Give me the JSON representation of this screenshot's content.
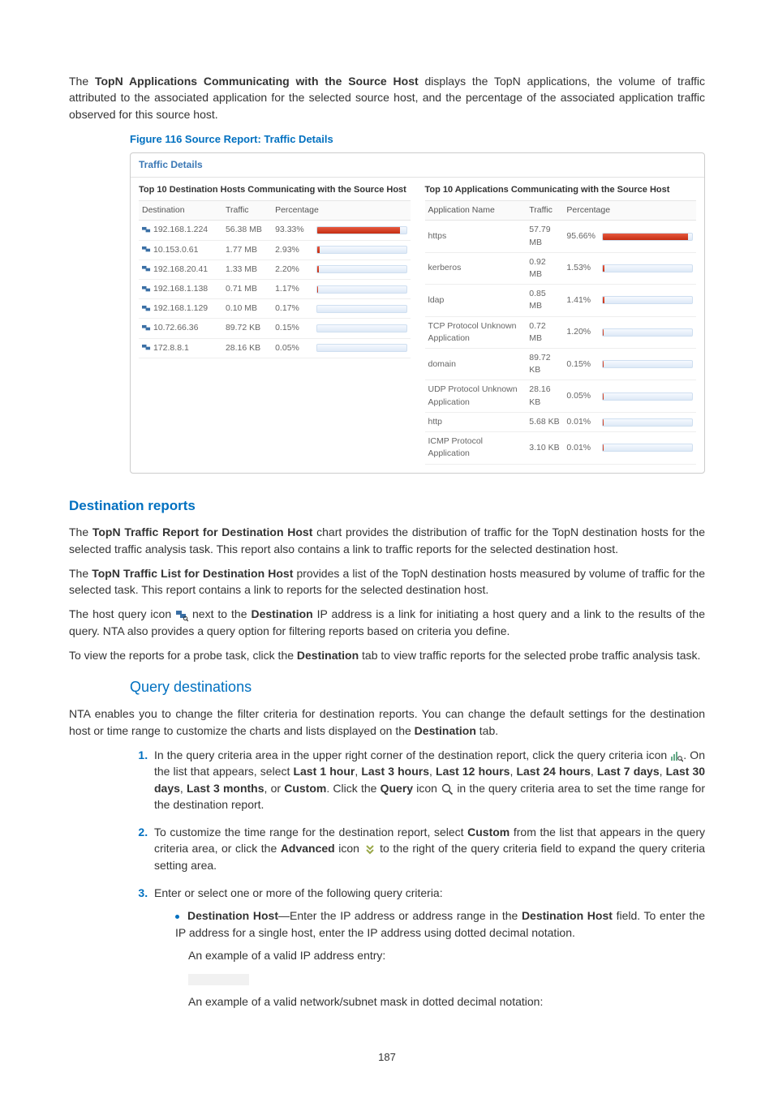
{
  "intro": {
    "p1_prefix": "The ",
    "p1_bold": "TopN Applications Communicating with the Source Host",
    "p1_rest": " displays the TopN applications, the volume of traffic attributed to the associated application for the selected source host, and the percentage of the associated application traffic observed for this source host."
  },
  "figure": {
    "caption": "Figure 116 Source Report: Traffic Details",
    "panel_title": "Traffic Details",
    "left": {
      "title": "Top 10 Destination Hosts Communicating with the Source Host",
      "headers": [
        "Destination",
        "Traffic",
        "Percentage"
      ],
      "rows": [
        {
          "dest": "192.168.1.224",
          "traffic": "56.38 MB",
          "pct": "93.33%",
          "barpct": 93.33
        },
        {
          "dest": "10.153.0.61",
          "traffic": "1.77 MB",
          "pct": "2.93%",
          "barpct": 2.93
        },
        {
          "dest": "192.168.20.41",
          "traffic": "1.33 MB",
          "pct": "2.20%",
          "barpct": 2.2
        },
        {
          "dest": "192.168.1.138",
          "traffic": "0.71 MB",
          "pct": "1.17%",
          "barpct": 1.17
        },
        {
          "dest": "192.168.1.129",
          "traffic": "0.10 MB",
          "pct": "0.17%",
          "barpct": 0.17
        },
        {
          "dest": "10.72.66.36",
          "traffic": "89.72 KB",
          "pct": "0.15%",
          "barpct": 0.15
        },
        {
          "dest": "172.8.8.1",
          "traffic": "28.16 KB",
          "pct": "0.05%",
          "barpct": 0.05
        }
      ]
    },
    "right": {
      "title": "Top 10 Applications Communicating with the Source Host",
      "headers": [
        "Application Name",
        "Traffic",
        "Percentage"
      ],
      "rows": [
        {
          "app": "https",
          "traffic": "57.79 MB",
          "pct": "95.66%",
          "barpct": 95.66
        },
        {
          "app": "kerberos",
          "traffic": "0.92 MB",
          "pct": "1.53%",
          "barpct": 1.53
        },
        {
          "app": "ldap",
          "traffic": "0.85 MB",
          "pct": "1.41%",
          "barpct": 1.41
        },
        {
          "app": "TCP Protocol Unknown Application",
          "traffic": "0.72 MB",
          "pct": "1.20%",
          "barpct": 1.2
        },
        {
          "app": "domain",
          "traffic": "89.72 KB",
          "pct": "0.15%",
          "barpct": 0.15
        },
        {
          "app": "UDP Protocol Unknown Application",
          "traffic": "28.16 KB",
          "pct": "0.05%",
          "barpct": 0.05
        },
        {
          "app": "http",
          "traffic": "5.68 KB",
          "pct": "0.01%",
          "barpct": 0.01
        },
        {
          "app": "ICMP Protocol Application",
          "traffic": "3.10 KB",
          "pct": "0.01%",
          "barpct": 0.01
        }
      ]
    }
  },
  "section_dest": {
    "heading": "Destination reports",
    "p1_a": "The ",
    "p1_b": "TopN Traffic Report for Destination Host",
    "p1_c": " chart provides the distribution of traffic for the TopN destination hosts for the selected traffic analysis task. This report also contains a link to traffic reports for the selected destination host.",
    "p2_a": "The ",
    "p2_b": "TopN Traffic List for Destination Host",
    "p2_c": " provides a list of the TopN destination hosts measured by volume of traffic for the selected task. This report contains a link to reports for the selected destination host.",
    "p3_a": "The host query icon ",
    "p3_b": " next to the ",
    "p3_c": "Destination",
    "p3_d": " IP address is a link for initiating a host query and a link to the results of the query. NTA also provides a query option for filtering reports based on criteria you define.",
    "p4_a": "To view the reports for a probe task, click the ",
    "p4_b": "Destination",
    "p4_c": " tab to view traffic reports for the selected probe traffic analysis task."
  },
  "section_query": {
    "heading": "Query destinations",
    "p1_a": "NTA enables you to change the filter criteria for destination reports. You can change the default settings for the destination host or time range to customize the charts and lists displayed on the ",
    "p1_b": "Destination",
    "p1_c": " tab.",
    "step1_a": "In the query criteria area in the upper right corner of the destination report, click the query criteria icon ",
    "step1_b": ". On the list that appears, select ",
    "step1_opts": [
      "Last 1 hour",
      "Last 3 hours",
      "Last 12 hours",
      "Last 24 hours",
      "Last 7 days",
      "Last 30 days",
      "Last 3 months"
    ],
    "step1_custom": "Custom",
    "step1_click": ". Click the ",
    "step1_query": "Query",
    "step1_icon_after": " icon ",
    "step1_tail": " in the query criteria area to set the time range for the destination report.",
    "step2_a": "To customize the time range for the destination report, select ",
    "step2_b": "Custom",
    "step2_c": " from the list that appears in the query criteria area, or click the ",
    "step2_d": "Advanced",
    "step2_e": " icon ",
    "step2_f": " to the right of the query criteria field to expand the query criteria setting area.",
    "step3": "Enter or select one or more of the following query criteria:",
    "bullet1_a": "Destination Host",
    "bullet1_b": "—Enter the IP address or address range in the ",
    "bullet1_c": "Destination Host",
    "bullet1_d": " field. To enter the IP address for a single host, enter the IP address using dotted decimal notation.",
    "bullet1_line2": "An example of a valid IP address entry:",
    "bullet1_line3": "An example of a valid network/subnet mask in dotted decimal notation:"
  },
  "misc": {
    "or": ", or ",
    "comma": ", ",
    "page": "187"
  },
  "chart_data": [
    {
      "type": "bar",
      "title": "Top 10 Destination Hosts Communicating with the Source Host",
      "xlabel": "Destination",
      "ylabel": "Percentage",
      "ylim": [
        0,
        100
      ],
      "categories": [
        "192.168.1.224",
        "10.153.0.61",
        "192.168.20.41",
        "192.168.1.138",
        "192.168.1.129",
        "10.72.66.36",
        "172.8.8.1"
      ],
      "values": [
        93.33,
        2.93,
        2.2,
        1.17,
        0.17,
        0.15,
        0.05
      ]
    },
    {
      "type": "bar",
      "title": "Top 10 Applications Communicating with the Source Host",
      "xlabel": "Application Name",
      "ylabel": "Percentage",
      "ylim": [
        0,
        100
      ],
      "categories": [
        "https",
        "kerberos",
        "ldap",
        "TCP Protocol Unknown Application",
        "domain",
        "UDP Protocol Unknown Application",
        "http",
        "ICMP Protocol Application"
      ],
      "values": [
        95.66,
        1.53,
        1.41,
        1.2,
        0.15,
        0.05,
        0.01,
        0.01
      ]
    }
  ]
}
